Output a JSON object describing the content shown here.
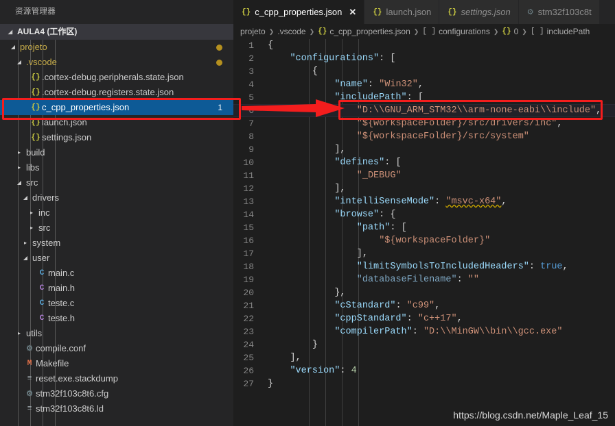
{
  "sidebar": {
    "title": "资源管理器",
    "workspace": {
      "label": "AULA4 (工作区)",
      "twisty": "open"
    },
    "tree": [
      {
        "label": "projeto",
        "indent": 1,
        "twisty": "open",
        "icon": "none",
        "color": "amber",
        "dot": true
      },
      {
        "label": ".vscode",
        "indent": 2,
        "twisty": "open",
        "icon": "none",
        "color": "amber",
        "dot": true
      },
      {
        "label": ".cortex-debug.peripherals.state.json",
        "indent": 3,
        "twisty": "none",
        "icon": "json"
      },
      {
        "label": ".cortex-debug.registers.state.json",
        "indent": 3,
        "twisty": "none",
        "icon": "json"
      },
      {
        "label": "c_cpp_properties.json",
        "indent": 3,
        "twisty": "none",
        "icon": "json",
        "selected": true,
        "badge": "1"
      },
      {
        "label": "launch.json",
        "indent": 3,
        "twisty": "none",
        "icon": "json"
      },
      {
        "label": "settings.json",
        "indent": 3,
        "twisty": "none",
        "icon": "json"
      },
      {
        "label": "build",
        "indent": 2,
        "twisty": "closed",
        "icon": "none"
      },
      {
        "label": "libs",
        "indent": 2,
        "twisty": "closed",
        "icon": "none"
      },
      {
        "label": "src",
        "indent": 2,
        "twisty": "open",
        "icon": "none"
      },
      {
        "label": "drivers",
        "indent": 3,
        "twisty": "open",
        "icon": "none"
      },
      {
        "label": "inc",
        "indent": 4,
        "twisty": "closed",
        "icon": "none"
      },
      {
        "label": "src",
        "indent": 4,
        "twisty": "closed",
        "icon": "none"
      },
      {
        "label": "system",
        "indent": 3,
        "twisty": "closed",
        "icon": "none"
      },
      {
        "label": "user",
        "indent": 3,
        "twisty": "open",
        "icon": "none"
      },
      {
        "label": "main.c",
        "indent": 4,
        "twisty": "none",
        "icon": "cfile",
        "glyph": "C"
      },
      {
        "label": "main.h",
        "indent": 4,
        "twisty": "none",
        "icon": "hfile",
        "glyph": "C"
      },
      {
        "label": "teste.c",
        "indent": 4,
        "twisty": "none",
        "icon": "cfile",
        "glyph": "C"
      },
      {
        "label": "teste.h",
        "indent": 4,
        "twisty": "none",
        "icon": "hfile",
        "glyph": "C"
      },
      {
        "label": "utils",
        "indent": 2,
        "twisty": "closed",
        "icon": "none"
      },
      {
        "label": "compile.conf",
        "indent": 2,
        "twisty": "none",
        "icon": "gear",
        "glyph": "⚙"
      },
      {
        "label": "Makefile",
        "indent": 2,
        "twisty": "none",
        "icon": "make",
        "glyph": "M"
      },
      {
        "label": "reset.exe.stackdump",
        "indent": 2,
        "twisty": "none",
        "icon": "txt",
        "glyph": "≡"
      },
      {
        "label": "stm32f103c8t6.cfg",
        "indent": 2,
        "twisty": "none",
        "icon": "gear",
        "glyph": "⚙"
      },
      {
        "label": "stm32f103c8t6.ld",
        "indent": 2,
        "twisty": "none",
        "icon": "txt",
        "glyph": "≡"
      }
    ]
  },
  "tabs": [
    {
      "label": "c_cpp_properties.json",
      "icon": "{}",
      "icon_kind": "json",
      "active": true,
      "italic": false,
      "close": "✕"
    },
    {
      "label": "launch.json",
      "icon": "{}",
      "icon_kind": "json",
      "active": false,
      "italic": false
    },
    {
      "label": "settings.json",
      "icon": "{}",
      "icon_kind": "json",
      "active": false,
      "italic": true
    },
    {
      "label": "stm32f103c8t",
      "icon": "⚙",
      "icon_kind": "gear",
      "active": false,
      "italic": false
    }
  ],
  "breadcrumb": [
    {
      "label": "projeto",
      "icon": ""
    },
    {
      "label": ".vscode",
      "icon": ""
    },
    {
      "label": "c_cpp_properties.json",
      "icon": "{}",
      "icon_kind": "json"
    },
    {
      "label": "configurations",
      "icon": "[ ]",
      "icon_kind": "br"
    },
    {
      "label": "0",
      "icon": "{}",
      "icon_kind": "json"
    },
    {
      "label": "includePath",
      "icon": "[ ]",
      "icon_kind": "br"
    }
  ],
  "code": {
    "language": "json",
    "current_line": 6,
    "lines": [
      {
        "n": 1,
        "text": "{"
      },
      {
        "n": 2,
        "text": "    \"configurations\": ["
      },
      {
        "n": 3,
        "text": "        {"
      },
      {
        "n": 4,
        "text": "            \"name\": \"Win32\","
      },
      {
        "n": 5,
        "text": "            \"includePath\": ["
      },
      {
        "n": 6,
        "text": "                \"D:\\\\GNU_ARM_STM32\\\\arm-none-eabi\\\\include\","
      },
      {
        "n": 7,
        "text": "                \"${workspaceFolder}/src/drivers/inc\","
      },
      {
        "n": 8,
        "text": "                \"${workspaceFolder}/src/system\""
      },
      {
        "n": 9,
        "text": "            ],"
      },
      {
        "n": 10,
        "text": "            \"defines\": ["
      },
      {
        "n": 11,
        "text": "                \"_DEBUG\""
      },
      {
        "n": 12,
        "text": "            ],"
      },
      {
        "n": 13,
        "text": "            \"intelliSenseMode\": \"msvc-x64\","
      },
      {
        "n": 14,
        "text": "            \"browse\": {"
      },
      {
        "n": 15,
        "text": "                \"path\": ["
      },
      {
        "n": 16,
        "text": "                    \"${workspaceFolder}\""
      },
      {
        "n": 17,
        "text": "                ],"
      },
      {
        "n": 18,
        "text": "                \"limitSymbolsToIncludedHeaders\": true,"
      },
      {
        "n": 19,
        "text": "                \"databaseFilename\": \"\""
      },
      {
        "n": 20,
        "text": "            },"
      },
      {
        "n": 21,
        "text": "            \"cStandard\": \"c99\","
      },
      {
        "n": 22,
        "text": "            \"cppStandard\": \"c++17\","
      },
      {
        "n": 23,
        "text": "            \"compilerPath\": \"D:\\\\MinGW\\\\bin\\\\gcc.exe\""
      },
      {
        "n": 24,
        "text": "        }"
      },
      {
        "n": 25,
        "text": "    ],"
      },
      {
        "n": 26,
        "text": "    \"version\": 4"
      },
      {
        "n": 27,
        "text": "}"
      }
    ],
    "warning_token": "msvc-x64"
  },
  "annotations": {
    "highlight_color": "#f41d1d",
    "sidebar_target": "c_cpp_properties.json",
    "code_target_line": 6
  },
  "watermark": "https://blog.csdn.net/Maple_Leaf_15"
}
